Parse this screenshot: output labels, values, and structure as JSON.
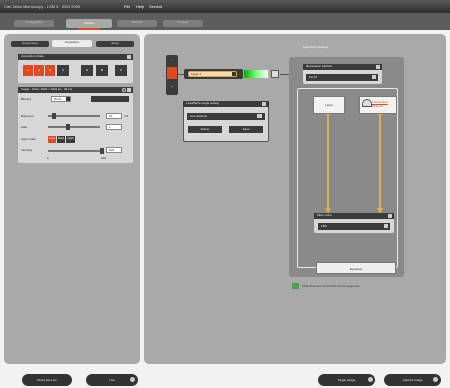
{
  "window": {
    "title": "Carl Zeiss Microscopy - LSM 5 · ZEN 2009",
    "menu": [
      "File",
      "Help",
      "Service"
    ]
  },
  "top_tabs": [
    {
      "label": "Configuration"
    },
    {
      "label": "Acquire"
    },
    {
      "label": "Process"
    },
    {
      "label": "Analysis"
    }
  ],
  "left_tabs": [
    {
      "label": "Experiment"
    },
    {
      "label": "Acquisition"
    },
    {
      "label": "Setup"
    }
  ],
  "acq_mode": {
    "title": "Acquisition Mode",
    "buttons": [
      "1",
      "2",
      "3",
      "4",
      "A",
      "B",
      "C"
    ]
  },
  "image": {
    "title": "Image · Scan: 1024 × 1024 px · 39 ms",
    "binning_label": "Binning",
    "binning_value": "None",
    "exposure_label": "Exposure",
    "exposure_value": "10",
    "exposure_unit": "ms",
    "gain_label": "Gain",
    "gain_value": "1",
    "light_label": "Light mode",
    "light_options": [
      "Low",
      "Med",
      "High"
    ],
    "intensity_label": "Intensity",
    "intensity_value": "100",
    "intensity_min": "0",
    "intensity_max": "100"
  },
  "lightpath": {
    "title": "Light Path Settings",
    "source_value": "Laser 1",
    "bracket_label": "Load/Store single setting",
    "preset_value": "Live Settings",
    "save_label": "Delete",
    "load_label": "Save",
    "cube_title": "Illumination Method",
    "cube_value": "FLUO",
    "lamp_label": "Lamp",
    "detector_label": "Transmitted Detector",
    "filter_title": "Filter Cube",
    "filter_value": "FBS",
    "eyepiece_label": "Eyepiece",
    "note_text": "Objectives and control the above sequence"
  },
  "bottom": {
    "setlive_label": "Reset Set Live",
    "live_label": "Live",
    "single_label": "Single Image",
    "capture_label": "Capture Image"
  },
  "colors": {
    "accent": "#e04a23",
    "panel": "#3b3b3b",
    "canvas": "#a9a9a9"
  }
}
